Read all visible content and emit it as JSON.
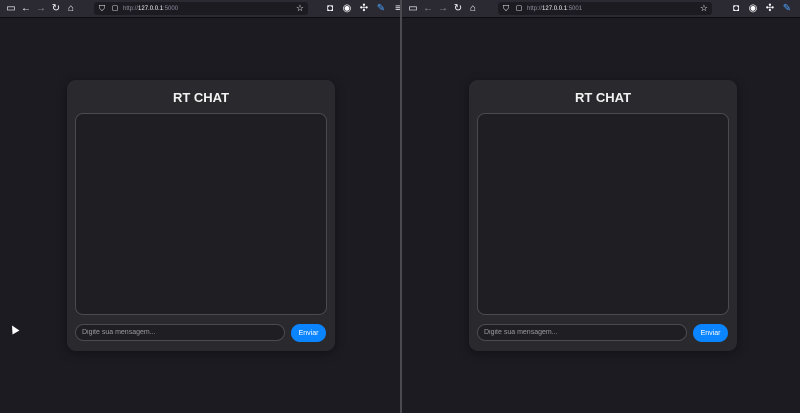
{
  "windows": [
    {
      "url_prefix": "http://",
      "url_host": "127.0.0.1",
      "url_port": ":5000",
      "chat": {
        "title": "RT CHAT",
        "input_placeholder": "Digite sua mensagem...",
        "send_label": "Enviar"
      }
    },
    {
      "url_prefix": "http://",
      "url_host": "127.0.0.1",
      "url_port": ":5001",
      "chat": {
        "title": "RT CHAT",
        "input_placeholder": "Digite sua mensagem...",
        "send_label": "Enviar"
      }
    }
  ],
  "colors": {
    "background": "#1c1b22",
    "card": "#2a2a2e",
    "accent": "#0a84ff"
  }
}
